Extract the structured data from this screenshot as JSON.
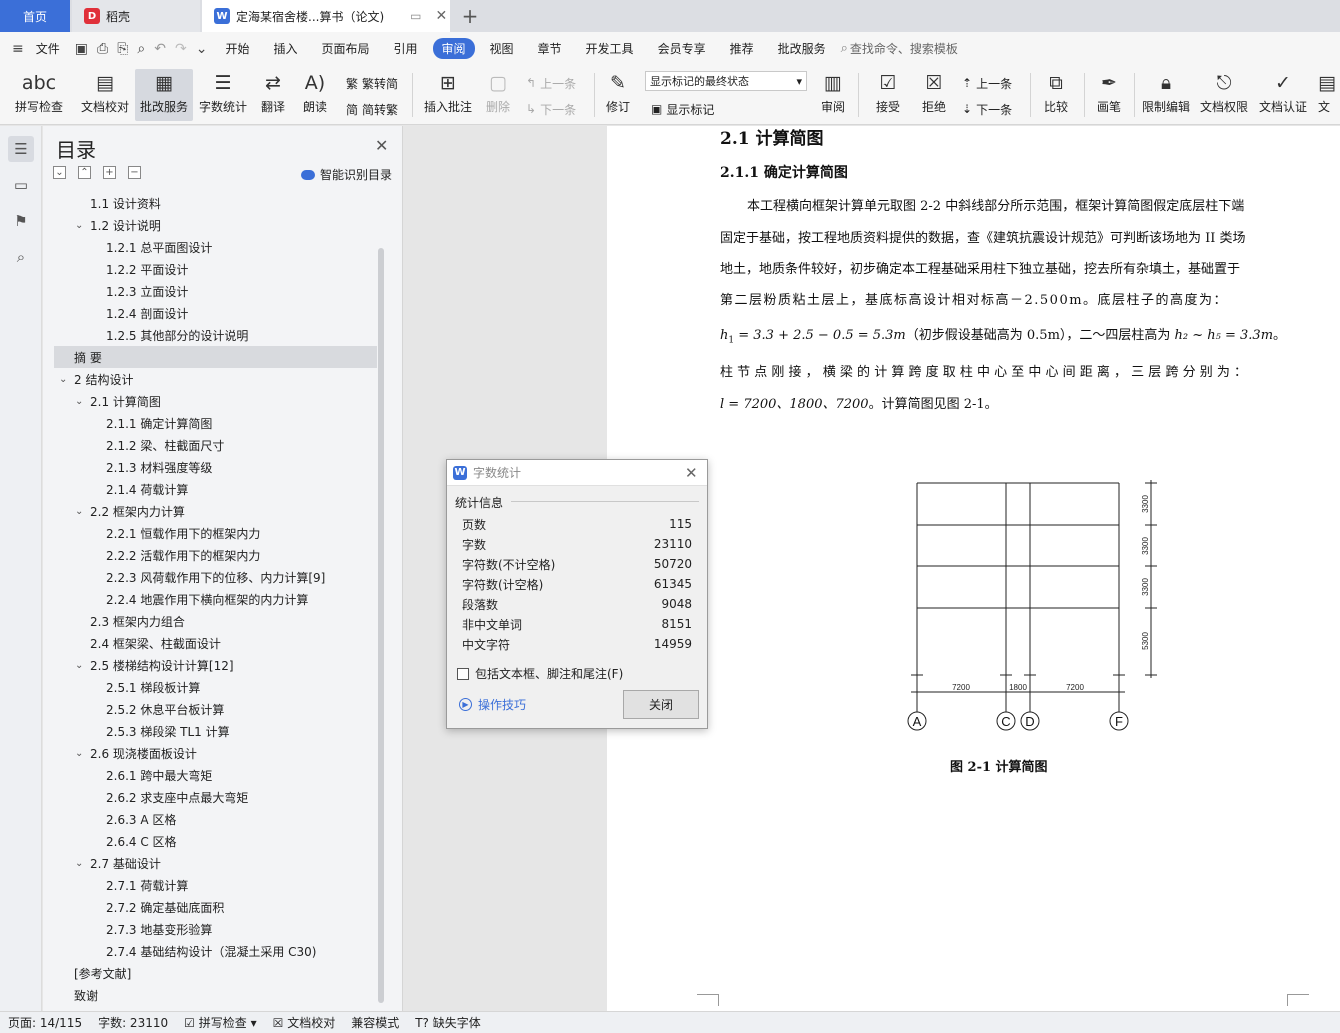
{
  "tabs": {
    "home": "首页",
    "daoke": "稻壳",
    "doc": "定海某宿舍楼...算书（论文)"
  },
  "menu": {
    "file": "文件",
    "items": [
      "开始",
      "插入",
      "页面布局",
      "引用",
      "审阅",
      "视图",
      "章节",
      "开发工具",
      "会员专享",
      "推荐",
      "批改服务"
    ],
    "active": "审阅",
    "search": "查找命令、搜索模板"
  },
  "ribbon": {
    "spell": "拼写检查",
    "proof": "文档校对",
    "correct": "批改服务",
    "count": "字数统计",
    "translate": "翻译",
    "read": "朗读",
    "to_trad": "繁转简",
    "to_simp": "简转繁",
    "insert_comment": "插入批注",
    "delete": "删除",
    "prev": "上一条",
    "next": "下一条",
    "revise": "修订",
    "markup_state": "显示标记的最终状态",
    "show_markup": "显示标记",
    "review": "审阅",
    "accept": "接受",
    "reject": "拒绝",
    "prev2": "上一条",
    "next2": "下一条",
    "compare": "比较",
    "pen": "画笔",
    "restrict": "限制编辑",
    "permission": "文档权限",
    "cert": "文档认证",
    "more": "文"
  },
  "toc": {
    "title": "目录",
    "smart": "智能识别目录",
    "items": [
      {
        "label": "1.1  设计资料",
        "level": 2,
        "chev": false
      },
      {
        "label": "1.2 设计说明",
        "level": 2,
        "chev": true
      },
      {
        "label": "1.2.1 总平面图设计",
        "level": 3,
        "chev": false
      },
      {
        "label": "1.2.2  平面设计",
        "level": 3,
        "chev": false
      },
      {
        "label": "1.2.3  立面设计",
        "level": 3,
        "chev": false
      },
      {
        "label": "1.2.4  剖面设计",
        "level": 3,
        "chev": false
      },
      {
        "label": "1.2.5  其他部分的设计说明",
        "level": 3,
        "chev": false
      },
      {
        "label": "摘    要",
        "level": 1,
        "chev": false
      },
      {
        "label": "2  结构设计",
        "level": 1,
        "chev": true
      },
      {
        "label": "2.1 计算简图",
        "level": 2,
        "chev": true
      },
      {
        "label": "2.1.1 确定计算简图",
        "level": 3,
        "chev": false
      },
      {
        "label": "2.1.2 梁、柱截面尺寸",
        "level": 3,
        "chev": false
      },
      {
        "label": "2.1.3 材料强度等级",
        "level": 3,
        "chev": false
      },
      {
        "label": "2.1.4 荷载计算",
        "level": 3,
        "chev": false
      },
      {
        "label": "2.2 框架内力计算",
        "level": 2,
        "chev": true
      },
      {
        "label": "2.2.1 恒载作用下的框架内力",
        "level": 3,
        "chev": false
      },
      {
        "label": "2.2.2 活载作用下的框架内力",
        "level": 3,
        "chev": false
      },
      {
        "label": "2.2.3 风荷载作用下的位移、内力计算[9]",
        "level": 3,
        "chev": false
      },
      {
        "label": "2.2.4 地震作用下横向框架的内力计算",
        "level": 3,
        "chev": false
      },
      {
        "label": "2.3 框架内力组合",
        "level": 2,
        "chev": false
      },
      {
        "label": "2.4 框架梁、柱截面设计",
        "level": 2,
        "chev": false
      },
      {
        "label": "2.5 楼梯结构设计计算[12]",
        "level": 2,
        "chev": true
      },
      {
        "label": "2.5.1 梯段板计算",
        "level": 3,
        "chev": false
      },
      {
        "label": "2.5.2 休息平台板计算",
        "level": 3,
        "chev": false
      },
      {
        "label": "2.5.3 梯段梁 TL1 计算",
        "level": 3,
        "chev": false
      },
      {
        "label": "2.6 现浇楼面板设计",
        "level": 2,
        "chev": true
      },
      {
        "label": "2.6.1 跨中最大弯矩",
        "level": 3,
        "chev": false
      },
      {
        "label": "2.6.2 求支座中点最大弯矩",
        "level": 3,
        "chev": false
      },
      {
        "label": "2.6.3 A 区格",
        "level": 3,
        "chev": false
      },
      {
        "label": "2.6.4 C 区格",
        "level": 3,
        "chev": false
      },
      {
        "label": "2.7 基础设计",
        "level": 2,
        "chev": true
      },
      {
        "label": "2.7.1 荷载计算",
        "level": 3,
        "chev": false
      },
      {
        "label": "2.7.2 确定基础底面积",
        "level": 3,
        "chev": false
      },
      {
        "label": "2.7.3 地基变形验算",
        "level": 3,
        "chev": false
      },
      {
        "label": "2.7.4 基础结构设计（混凝土采用 C30)",
        "level": 3,
        "chev": false
      },
      {
        "label": "[参考文献]",
        "level": 1,
        "chev": false
      },
      {
        "label": "致谢",
        "level": 1,
        "chev": false
      }
    ],
    "highlight_index": 7
  },
  "doc": {
    "h2": "2.1 计算简图",
    "h3": "2.1.1 确定计算简图",
    "p1": "本工程横向框架计算单元取图 2-2 中斜线部分所示范围，框架计算简图假定底层柱下端",
    "p2": "固定于基础，按工程地质资料提供的数据，查《建筑抗震设计规范》可判断该场地为 II 类场",
    "p3": "地土，地质条件较好，初步确定本工程基础采用柱下独立基础，挖去所有杂填土，基础置于",
    "p4": "第二层粉质粘土层上，基底标高设计相对标高－2.500m。底层柱子的高度为：",
    "p5a": "h",
    "p5b": " = 3.3 + 2.5 − 0.5 = 5.3m",
    "p5c": "（初步假设基础高为 0.5m），二～四层柱高为 ",
    "p5d": "h₂ ~ h₅ = 3.3m",
    "p5e": "。",
    "p6": "柱 节 点 刚 接 ， 横 梁 的 计 算 跨 度 取 柱 中 心 至 中 心 间 距 离 ， 三 层 跨 分 别 为 ：",
    "p7a": "l",
    "p7b": " = 7200、1800、7200",
    "p7c": "。计算简图见图 2-1。",
    "fig_caption": "图 2-1   计算简图",
    "fig": {
      "spans": [
        "7200",
        "1800",
        "7200"
      ],
      "heights": [
        "3300",
        "3300",
        "3300",
        "5300"
      ],
      "axes": [
        "A",
        "C",
        "D",
        "F"
      ]
    }
  },
  "dialog": {
    "title": "字数统计",
    "group": "统计信息",
    "rows": [
      {
        "k": "页数",
        "v": "115"
      },
      {
        "k": "字数",
        "v": "23110"
      },
      {
        "k": "字符数(不计空格)",
        "v": "50720"
      },
      {
        "k": "字符数(计空格)",
        "v": "61345"
      },
      {
        "k": "段落数",
        "v": "9048"
      },
      {
        "k": "非中文单词",
        "v": "8151"
      },
      {
        "k": "中文字符",
        "v": "14959"
      }
    ],
    "checkbox": "包括文本框、脚注和尾注(F)",
    "tips": "操作技巧",
    "close": "关闭"
  },
  "status": {
    "page": "页面: 14/115",
    "words": "字数: 23110",
    "spell": "拼写检查",
    "proof": "文档校对",
    "compat": "兼容模式",
    "missing_font": "缺失字体"
  },
  "colors": {
    "accent": "#3b6fd8",
    "wps_red": "#e0303a"
  }
}
